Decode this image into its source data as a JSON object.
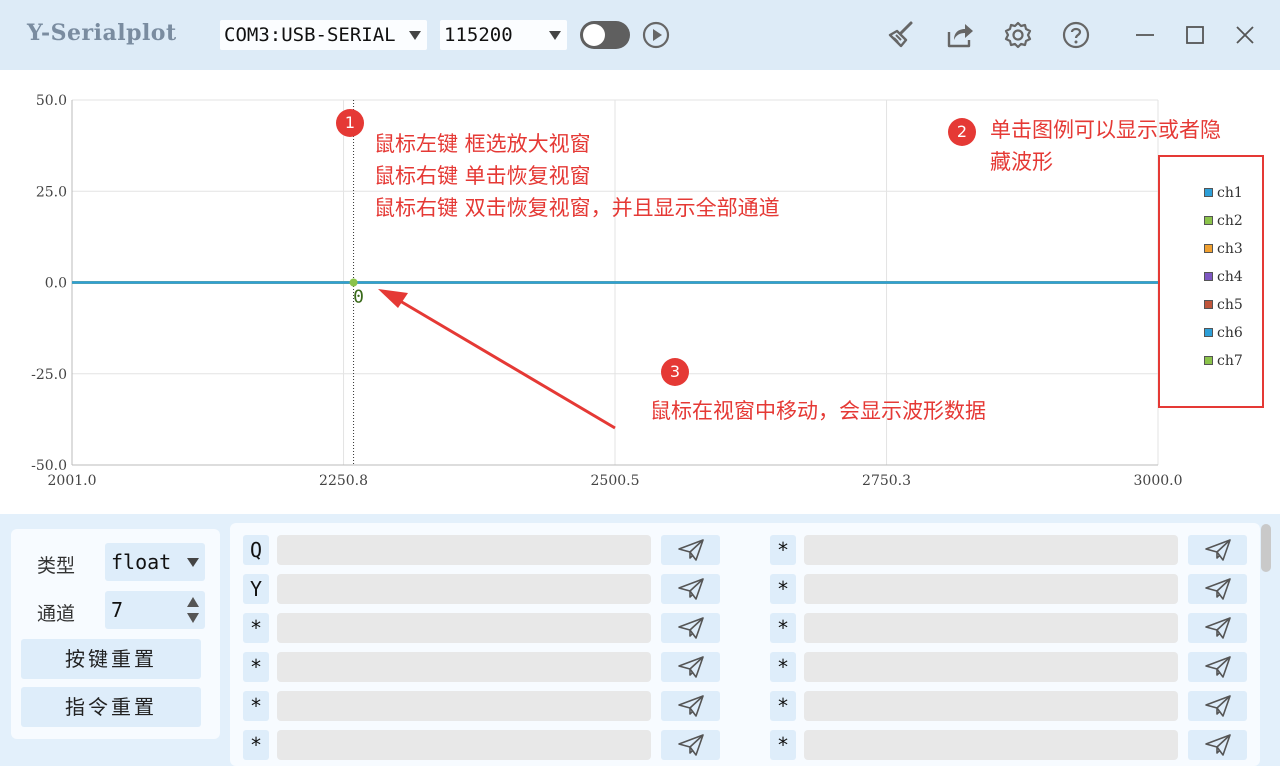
{
  "app": {
    "title": "Y-Serialplot"
  },
  "toolbar": {
    "port": "COM3:USB-SERIAL",
    "baud": "115200",
    "connection_toggle": "off",
    "icons": [
      "play-icon",
      "broom-icon",
      "share-icon",
      "gear-icon",
      "help-icon",
      "minimize-icon",
      "maximize-icon",
      "close-icon"
    ]
  },
  "chart_data": {
    "type": "line",
    "x_ticks": [
      "2001.0",
      "2250.8",
      "2500.5",
      "2750.3",
      "3000.0"
    ],
    "y_ticks": [
      "50.0",
      "25.0",
      "0.0",
      "-25.0",
      "-50.0"
    ],
    "xlim": [
      2001.0,
      3000.0
    ],
    "ylim": [
      -50.0,
      50.0
    ],
    "grid": true,
    "series": [
      {
        "name": "ch1",
        "color": "#2d9fd8",
        "x": [
          2001.0,
          3000.0
        ],
        "y": [
          0,
          0
        ]
      },
      {
        "name": "ch2",
        "color": "#8bc34a",
        "x": [
          2001.0,
          3000.0
        ],
        "y": [
          0,
          0
        ]
      },
      {
        "name": "ch3",
        "color": "#f0a030",
        "x": [
          2001.0,
          3000.0
        ],
        "y": [
          0,
          0
        ]
      },
      {
        "name": "ch4",
        "color": "#7e57c2",
        "x": [
          2001.0,
          3000.0
        ],
        "y": [
          0,
          0
        ]
      },
      {
        "name": "ch5",
        "color": "#c0553a",
        "x": [
          2001.0,
          3000.0
        ],
        "y": [
          0,
          0
        ]
      },
      {
        "name": "ch6",
        "color": "#2d9fd8",
        "x": [
          2001.0,
          3000.0
        ],
        "y": [
          0,
          0
        ]
      },
      {
        "name": "ch7",
        "color": "#8bc34a",
        "x": [
          2001.0,
          3000.0
        ],
        "y": [
          0,
          0
        ]
      }
    ],
    "cursor": {
      "x": 2260.0,
      "y": 0,
      "label": "0"
    },
    "legend": "right"
  },
  "annotations": {
    "a1": {
      "num": "1",
      "lines": [
        "鼠标左键 框选放大视窗",
        "鼠标右键 单击恢复视窗",
        "鼠标右键 双击恢复视窗，并且显示全部通道"
      ]
    },
    "a2": {
      "num": "2",
      "lines": [
        "单击图例可以显示或者隐",
        "藏波形"
      ]
    },
    "a3": {
      "num": "3",
      "lines": [
        "鼠标在视窗中移动，会显示波形数据"
      ]
    }
  },
  "settings": {
    "type_label": "类型",
    "type_value": "float",
    "channel_label": "通道",
    "channel_value": "7",
    "reset_keys": "按键重置",
    "reset_cmds": "指令重置"
  },
  "commands": {
    "left": [
      "Q",
      "Y",
      "*",
      "*",
      "*",
      "*"
    ],
    "right": [
      "*",
      "*",
      "*",
      "*",
      "*",
      "*"
    ]
  },
  "colors": {
    "accent": "#e53935",
    "panel": "#deedfa"
  }
}
